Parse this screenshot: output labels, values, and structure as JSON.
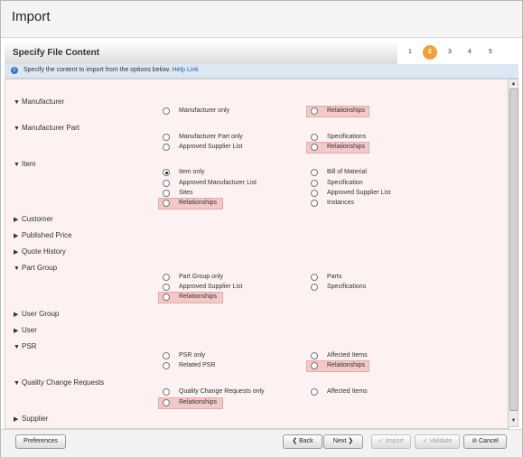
{
  "title": "Import",
  "step_title": "Specify File Content",
  "steps": [
    "1",
    "2",
    "3",
    "4",
    "5"
  ],
  "active_step": 2,
  "info": {
    "text": "Specify the content to import from the options below.",
    "link": "Help Link"
  },
  "sections": {
    "manufacturer": {
      "label": "Manufacturer",
      "expanded": true,
      "opt": [
        "Manufacturer only",
        "Relationships"
      ]
    },
    "manufacturer_part": {
      "label": "Manufacturer Part",
      "expanded": true,
      "opt": [
        "Manufacturer Part only",
        "Specifications",
        "Approved Supplier List",
        "Relationships"
      ]
    },
    "item": {
      "label": "Item",
      "expanded": true,
      "opt": [
        "Item only",
        "Bill of Material",
        "Approved Manufacturer List",
        "Specification",
        "Sites",
        "Approved Supplier List",
        "Relationships",
        "Instances"
      ]
    },
    "customer": {
      "label": "Customer",
      "expanded": false
    },
    "published_price": {
      "label": "Published Price",
      "expanded": false
    },
    "quote_history": {
      "label": "Quote History",
      "expanded": false
    },
    "part_group": {
      "label": "Part Group",
      "expanded": true,
      "opt": [
        "Part Group only",
        "Parts",
        "Approved Supplier List",
        "Specifications",
        "Relationships"
      ]
    },
    "user_group": {
      "label": "User Group",
      "expanded": false
    },
    "user": {
      "label": "User",
      "expanded": false
    },
    "psr": {
      "label": "PSR",
      "expanded": true,
      "opt": [
        "PSR only",
        "Affected Items",
        "Related PSR",
        "Relationships"
      ]
    },
    "qcr": {
      "label": "Quality Change Requests",
      "expanded": true,
      "opt": [
        "Quality Change Requests only",
        "Affected Items",
        "Relationships"
      ]
    },
    "supplier": {
      "label": "Supplier",
      "expanded": false
    }
  },
  "footer": {
    "preferences": "Preferences",
    "back": "Back",
    "next": "Next",
    "import": "Import",
    "validate": "Validate",
    "cancel": "Cancel"
  },
  "colors": {
    "highlight": "#f4c8c8",
    "active_step": "#f0a040",
    "content_bg": "#fdf1f1"
  }
}
